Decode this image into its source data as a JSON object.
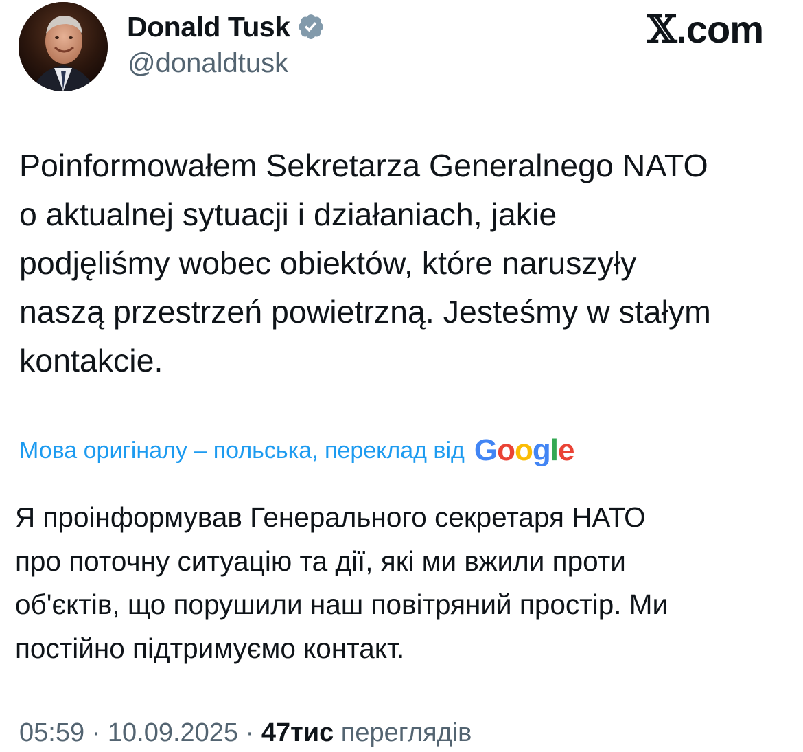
{
  "author": {
    "display_name": "Donald Tusk",
    "handle": "@donaldtusk",
    "verified": true,
    "avatar_icon": "profile-photo"
  },
  "site": {
    "logo_x": "𝕏",
    "logo_domain": ".com"
  },
  "tweet": {
    "original_text": "Poinformowałem Sekretarza Generalnego NATO\no aktualnej sytuacji i działaniach, jakie\npodjęliśmy wobec obiektów, które naruszyły\nnaszą przestrzeń powietrzną. Jesteśmy w stałym\nkontakcie.",
    "translation_label": "Мова оригіналу – польська, переклад від",
    "translation_provider": "Google",
    "translated_text": "Я проінформував Генерального секретаря НАТО\nпро поточну ситуацію та дії, які ми вжили проти\nоб'єктів, що порушили наш повітряний простір. Ми\nпостійно підтримуємо контакт."
  },
  "meta": {
    "time": "05:59",
    "separator": "·",
    "date": "10.09.2025",
    "views_count": "47тис",
    "views_label": "переглядів"
  },
  "colors": {
    "text_primary": "#0f1419",
    "text_secondary": "#536471",
    "link_blue": "#1d9bf0",
    "verified_gray": "#829aab",
    "google_blue": "#4285f4",
    "google_red": "#ea4335",
    "google_yellow": "#fbbc05",
    "google_green": "#34a853"
  }
}
